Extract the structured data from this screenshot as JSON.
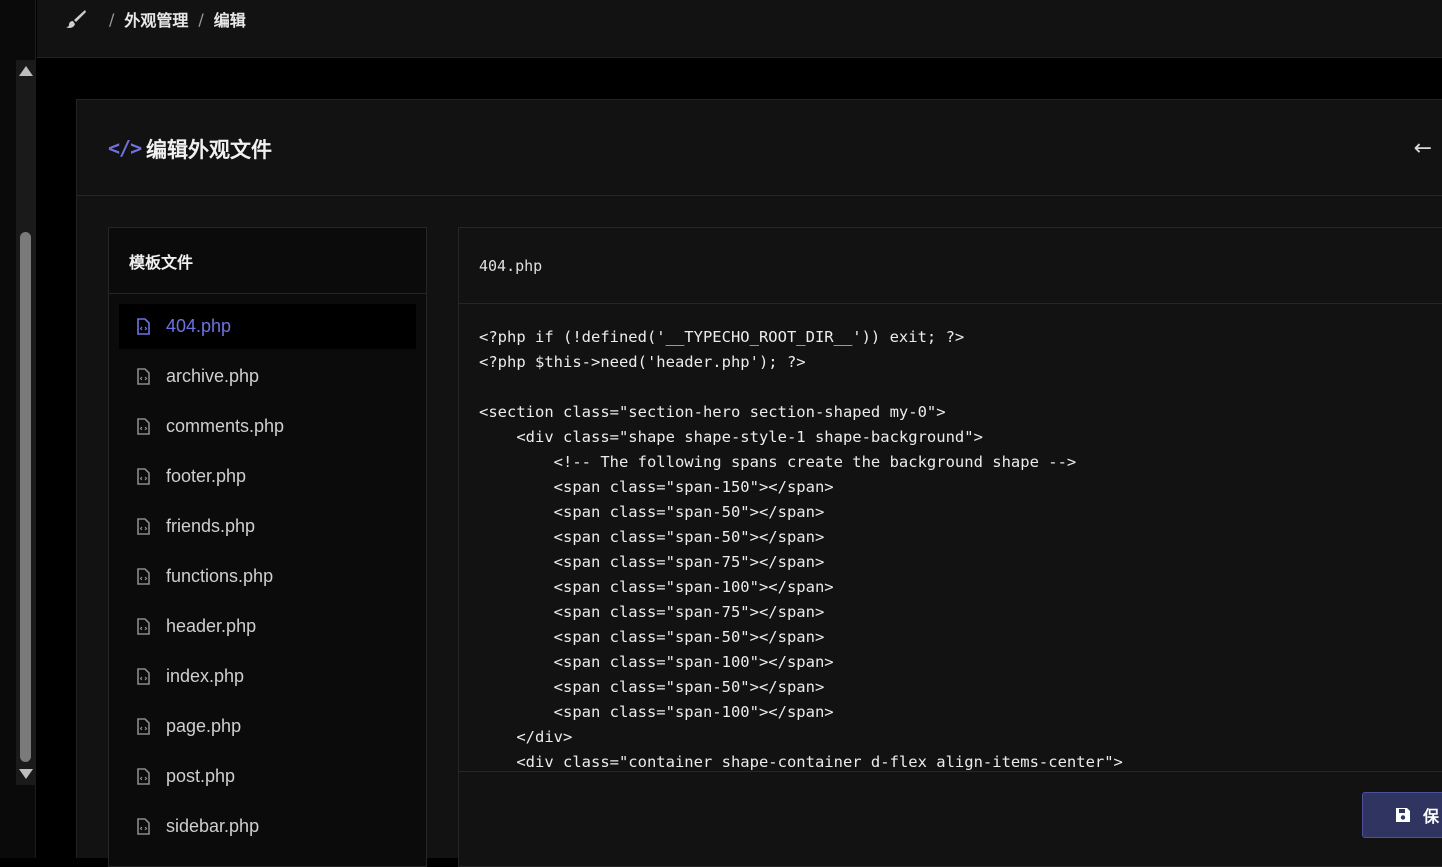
{
  "breadcrumb": {
    "items": [
      "外观管理",
      "编辑"
    ],
    "separator": "/"
  },
  "card": {
    "title": "编辑外观文件",
    "code_icon": "</>",
    "back_icon": "←"
  },
  "files": {
    "header": "模板文件",
    "items": [
      {
        "label": "404.php",
        "active": true
      },
      {
        "label": "archive.php"
      },
      {
        "label": "comments.php"
      },
      {
        "label": "footer.php"
      },
      {
        "label": "friends.php"
      },
      {
        "label": "functions.php"
      },
      {
        "label": "header.php"
      },
      {
        "label": "index.php"
      },
      {
        "label": "page.php"
      },
      {
        "label": "post.php"
      },
      {
        "label": "sidebar.php"
      }
    ]
  },
  "editor": {
    "filename": "404.php",
    "lines": [
      "<?php if (!defined('__TYPECHO_ROOT_DIR__')) exit; ?>",
      "<?php $this->need('header.php'); ?>",
      "",
      "<section class=\"section-hero section-shaped my-0\">",
      "    <div class=\"shape shape-style-1 shape-background\">",
      "        <!-- The following spans create the background shape -->",
      "        <span class=\"span-150\"></span>",
      "        <span class=\"span-50\"></span>",
      "        <span class=\"span-50\"></span>",
      "        <span class=\"span-75\"></span>",
      "        <span class=\"span-100\"></span>",
      "        <span class=\"span-75\"></span>",
      "        <span class=\"span-50\"></span>",
      "        <span class=\"span-100\"></span>",
      "        <span class=\"span-50\"></span>",
      "        <span class=\"span-100\"></span>",
      "    </div>",
      "    <div class=\"container shape-container d-flex align-items-center\">"
    ]
  },
  "actions": {
    "save_label": "保"
  },
  "icons": {
    "brush": "brush-icon",
    "file": "file-code-icon",
    "save": "floppy-disk-icon"
  },
  "colors": {
    "accent": "#6e72e0",
    "background": "#121212",
    "button": "#2f3560"
  }
}
